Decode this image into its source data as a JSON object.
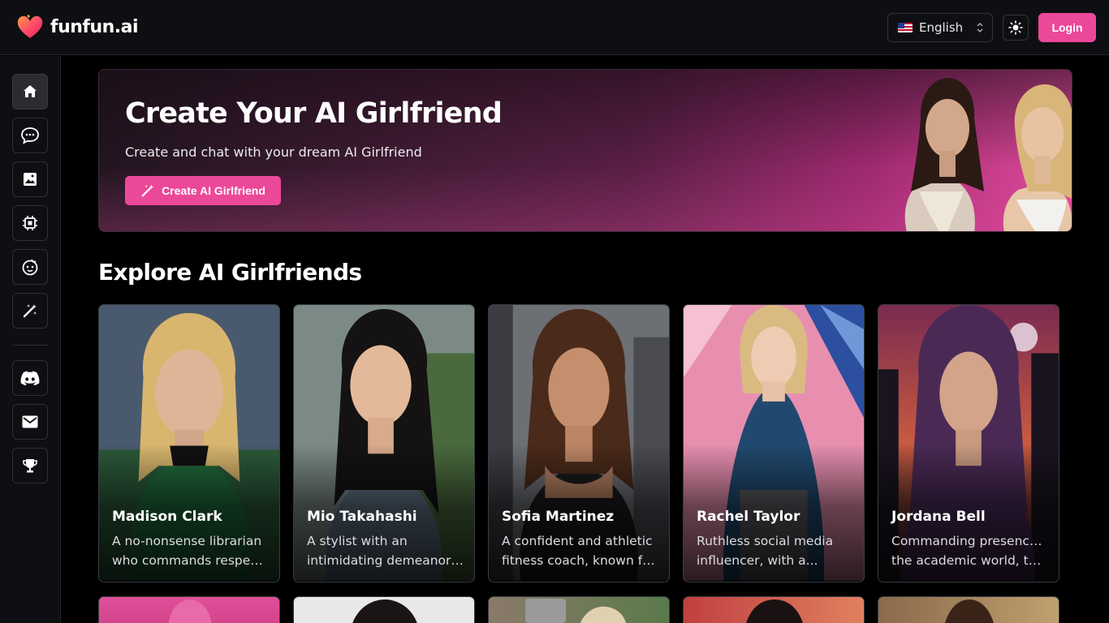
{
  "header": {
    "brand": "funfun.ai",
    "language": "English",
    "login_label": "Login"
  },
  "sidebar": {
    "items": [
      {
        "name": "home",
        "icon": "home-icon",
        "active": true
      },
      {
        "name": "chat",
        "icon": "chat-icon",
        "active": false
      },
      {
        "name": "gallery",
        "icon": "image-icon",
        "active": false
      },
      {
        "name": "generator",
        "icon": "chip-icon",
        "active": false
      },
      {
        "name": "companions",
        "icon": "face-icon",
        "active": false
      },
      {
        "name": "create",
        "icon": "magic-wand-icon",
        "active": false
      },
      {
        "name": "discord",
        "icon": "discord-icon",
        "active": false
      },
      {
        "name": "contact",
        "icon": "mail-icon",
        "active": false
      },
      {
        "name": "rewards",
        "icon": "trophy-icon",
        "active": false
      }
    ]
  },
  "banner": {
    "title": "Create Your AI Girlfriend",
    "subtitle": "Create and chat with your dream AI Girlfriend",
    "button_label": "Create AI Girlfriend"
  },
  "explore": {
    "title": "Explore AI Girlfriends",
    "cards": [
      {
        "name": "Madison Clark",
        "desc_line1": "A no-nonsense librarian",
        "desc_line2": "who commands respect..."
      },
      {
        "name": "Mio Takahashi",
        "desc_line1": "A stylist with an",
        "desc_line2": "intimidating demeanor,..."
      },
      {
        "name": "Sofia Martinez",
        "desc_line1": "A confident and athletic",
        "desc_line2": "fitness coach, known fo..."
      },
      {
        "name": "Rachel Taylor",
        "desc_line1": "Ruthless social media",
        "desc_line2": "influencer, with a..."
      },
      {
        "name": "Jordana Bell",
        "desc_line1": "Commanding presence in",
        "desc_line2": "the academic world, this..."
      }
    ]
  },
  "colors": {
    "accent": "#ec4899",
    "background": "#000000",
    "panel": "#0e0f12"
  }
}
